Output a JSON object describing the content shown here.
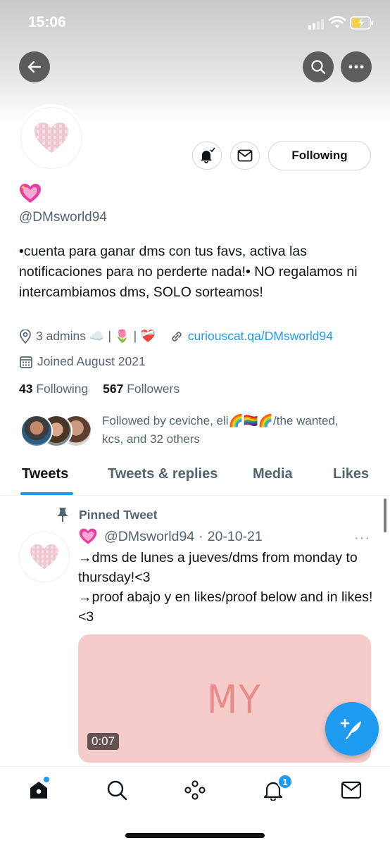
{
  "status_bar": {
    "time": "15:06"
  },
  "profile": {
    "handle": "@DMsworld94",
    "bio": "•cuenta para ganar dms con tus favs, activa las notificaciones para no perderte nada!• NO regalamos ni intercambiamos dms, SOLO sorteamos!",
    "location": "3 admins ☁️ | 🌷 | ❤️‍🩹",
    "website": "curiouscat.qa/DMsworld94",
    "joined": "Joined August 2021",
    "following_count": "43",
    "following_label": "Following",
    "followers_count": "567",
    "followers_label": "Followers",
    "followed_by": "Followed by ceviche, eli🌈🏳️‍🌈🌈/the wanted, kcs, and 32 others"
  },
  "actions": {
    "following_button": "Following"
  },
  "tabs": [
    {
      "label": "Tweets",
      "active": true
    },
    {
      "label": "Tweets & replies",
      "active": false
    },
    {
      "label": "Media",
      "active": false
    },
    {
      "label": "Likes",
      "active": false
    }
  ],
  "pinned_tweet": {
    "pinned_label": "Pinned Tweet",
    "handle": "@DMsworld94",
    "date": "20-10-21",
    "more": "···",
    "lines": [
      "→dms de lunes a jueves/dms from monday to thursday!<3",
      "→proof abajo y en likes/proof below and in likes!<3"
    ],
    "media_text": "MY",
    "duration": "0:07"
  },
  "bottom_nav": {
    "notification_badge": "1"
  },
  "colors": {
    "accent": "#1d9bf0",
    "secondary_text": "#536471",
    "media_bg": "#f6cccb"
  },
  "icons": [
    "back-arrow-icon",
    "search-icon",
    "more-icon",
    "bell-icon",
    "mail-icon",
    "location-icon",
    "link-icon",
    "calendar-icon",
    "pin-icon",
    "home-icon",
    "spaces-icon",
    "compose-icon"
  ]
}
